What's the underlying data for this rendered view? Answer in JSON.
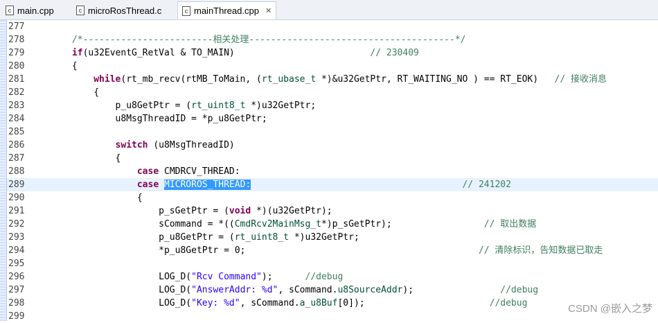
{
  "tabs": [
    {
      "label": "main.cpp",
      "icon": "c-file-icon"
    },
    {
      "label": "microRosThread.c",
      "icon": "c-file-icon"
    },
    {
      "label": "mainThread.cpp",
      "icon": "c-file-icon",
      "close": "✕"
    }
  ],
  "watermark": "CSDN @嵌入之梦",
  "colors": {
    "keyword": "#7f0055",
    "comment": "#3f7f5f",
    "string": "#2a00ff",
    "selection": "#3399ff"
  },
  "lines": [
    {
      "n": "277",
      "tokens": []
    },
    {
      "n": "278",
      "tokens": [
        [
          "cm",
          "        /*------------------------相关处理--------------------------------------*/"
        ]
      ]
    },
    {
      "n": "279",
      "tokens": [
        [
          "",
          "        "
        ],
        [
          "kw",
          "if"
        ],
        [
          "",
          "(u32EventG_RetVal & TO_MAIN)                         "
        ],
        [
          "cm",
          "// 230409"
        ]
      ]
    },
    {
      "n": "280",
      "tokens": [
        [
          "",
          "        {"
        ]
      ]
    },
    {
      "n": "281",
      "tokens": [
        [
          "",
          "            "
        ],
        [
          "kw",
          "while"
        ],
        [
          "",
          "(rt_mb_recv(rtMB_ToMain, ("
        ],
        [
          "ty",
          "rt_ubase_t"
        ],
        [
          "",
          " *)&u32GetPtr, RT_WAITING_NO ) == RT_EOK)   "
        ],
        [
          "cm",
          "// 接收消息"
        ]
      ]
    },
    {
      "n": "282",
      "tokens": [
        [
          "",
          "            {"
        ]
      ]
    },
    {
      "n": "283",
      "tokens": [
        [
          "",
          "                p_u8GetPtr = ("
        ],
        [
          "ty",
          "rt_uint8_t"
        ],
        [
          "",
          " *)u32GetPtr;"
        ]
      ]
    },
    {
      "n": "284",
      "tokens": [
        [
          "",
          "                u8MsgThreadID = *p_u8GetPtr;"
        ]
      ]
    },
    {
      "n": "285",
      "tokens": []
    },
    {
      "n": "286",
      "tokens": [
        [
          "",
          "                "
        ],
        [
          "kw",
          "switch"
        ],
        [
          "",
          " (u8MsgThreadID)"
        ]
      ]
    },
    {
      "n": "287",
      "tokens": [
        [
          "",
          "                {"
        ]
      ]
    },
    {
      "n": "288",
      "tokens": [
        [
          "",
          "                    "
        ],
        [
          "kw",
          "case"
        ],
        [
          "",
          " CMDRCV_THREAD:"
        ]
      ]
    },
    {
      "n": "289",
      "hl": true,
      "tokens": [
        [
          "",
          "                    "
        ],
        [
          "kw",
          "case"
        ],
        [
          "",
          " "
        ],
        [
          "sel",
          "MICROROS_THREAD:"
        ],
        [
          "",
          "                                       "
        ],
        [
          "cm",
          "// 241202"
        ]
      ]
    },
    {
      "n": "290",
      "tokens": [
        [
          "",
          "                    {"
        ]
      ]
    },
    {
      "n": "291",
      "tokens": [
        [
          "",
          "                        p_sGetPtr = ("
        ],
        [
          "kw",
          "void"
        ],
        [
          "",
          " *)(u32GetPtr);"
        ]
      ]
    },
    {
      "n": "292",
      "tokens": [
        [
          "",
          "                        sCommand = *(("
        ],
        [
          "ty",
          "CmdRcv2MainMsg_t"
        ],
        [
          "",
          "*)p_sGetPtr);                 "
        ],
        [
          "cm",
          "// 取出数据"
        ]
      ]
    },
    {
      "n": "293",
      "tokens": [
        [
          "",
          "                        p_u8GetPtr = ("
        ],
        [
          "ty",
          "rt_uint8_t"
        ],
        [
          "",
          " *)u32GetPtr;"
        ]
      ]
    },
    {
      "n": "294",
      "tokens": [
        [
          "",
          "                        *p_u8GetPtr = 0;                                           "
        ],
        [
          "cm",
          "// 清除标识，告知数据已取走"
        ]
      ]
    },
    {
      "n": "295",
      "tokens": []
    },
    {
      "n": "296",
      "tokens": [
        [
          "",
          "                        LOG_D("
        ],
        [
          "str",
          "\"Rcv Command\""
        ],
        [
          "",
          ");      "
        ],
        [
          "cm",
          "//debug"
        ]
      ]
    },
    {
      "n": "297",
      "tokens": [
        [
          "",
          "                        LOG_D("
        ],
        [
          "str",
          "\"AnswerAddr: %d\""
        ],
        [
          "",
          ", sCommand."
        ],
        [
          "ty",
          "u8SourceAddr"
        ],
        [
          "",
          ");                "
        ],
        [
          "cm",
          "//debug"
        ]
      ]
    },
    {
      "n": "298",
      "tokens": [
        [
          "",
          "                        LOG_D("
        ],
        [
          "str",
          "\"Key: %d\""
        ],
        [
          "",
          ", sCommand."
        ],
        [
          "ty",
          "a_u8Buf"
        ],
        [
          "",
          "[0]);                       "
        ],
        [
          "cm",
          "//debug"
        ]
      ]
    },
    {
      "n": "299",
      "tokens": []
    }
  ]
}
